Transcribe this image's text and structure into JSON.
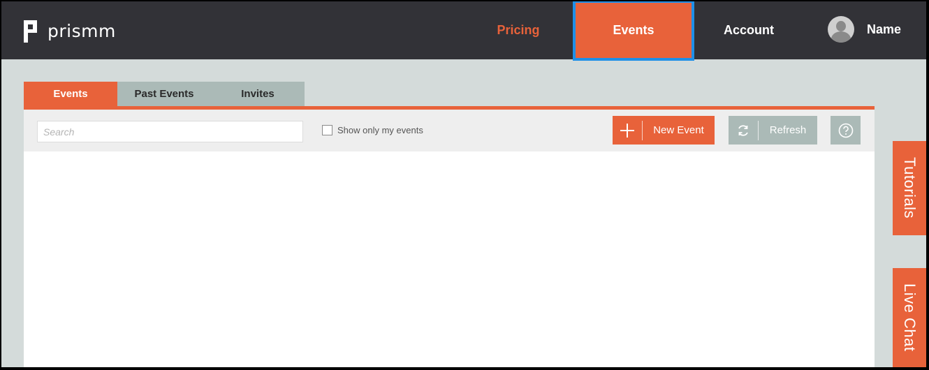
{
  "brand": {
    "name": "prismm",
    "accent": "#e8623a",
    "dark": "#323237",
    "highlight": "#1e90e8"
  },
  "nav": {
    "pricing": "Pricing",
    "events": "Events",
    "account": "Account"
  },
  "user": {
    "name": "Name",
    "avatar_icon": "user-avatar-icon"
  },
  "tabs": [
    {
      "label": "Events",
      "active": true
    },
    {
      "label": "Past Events"
    },
    {
      "label": "Invites"
    }
  ],
  "toolbar": {
    "search_placeholder": "Search",
    "filter_label": "Show only my events",
    "filter_checked": false,
    "new_event_label": "New Event",
    "refresh_label": "Refresh",
    "help_icon": "help-icon"
  },
  "side": {
    "tutorials": "Tutorials",
    "live_chat": "Live Chat"
  }
}
